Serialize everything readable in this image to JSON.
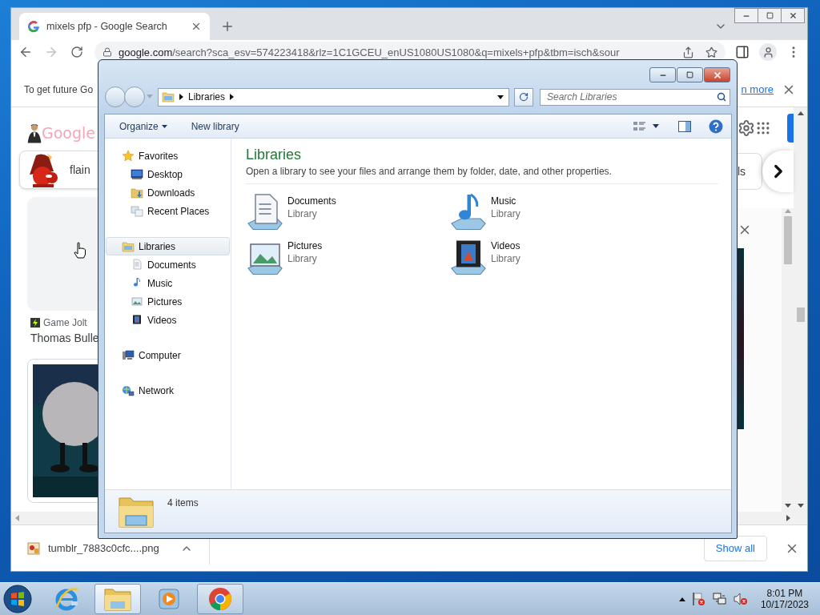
{
  "browser": {
    "tab": {
      "title": "mixels pfp - Google Search",
      "selected": true
    },
    "address": {
      "host": "google.com",
      "path": "/search?sca_esv=574223418&rlz=1C1GCEU_enUS1080US1080&q=mixels+pfp&tbm=isch&sour"
    },
    "infobar": {
      "text": "To get future Go",
      "link": "n more"
    },
    "logo": "Google",
    "chips": [
      {
        "label": "flain",
        "kind": "picture"
      },
      {
        "label": "ls",
        "kind": "plain"
      }
    ],
    "result": {
      "source": "Game Jolt",
      "title": "Thomas Bulle"
    },
    "download": {
      "file": "tumblr_7883c0cfc....png",
      "show_all": "Show all"
    }
  },
  "explorer": {
    "breadcrumb": "Libraries",
    "search_placeholder": "Search Libraries",
    "commands": [
      {
        "label": "Organize",
        "kind": "menu"
      },
      {
        "label": "New library",
        "kind": "button"
      }
    ],
    "nav": [
      {
        "label": "Favorites",
        "kind": "star",
        "selected": false,
        "children": [
          {
            "label": "Desktop",
            "kind": "desktop",
            "selected": false
          },
          {
            "label": "Downloads",
            "kind": "downloads",
            "selected": false
          },
          {
            "label": "Recent Places",
            "kind": "recent",
            "selected": false
          }
        ]
      },
      {
        "label": "Libraries",
        "kind": "library",
        "selected": true,
        "children": [
          {
            "label": "Documents",
            "kind": "documents",
            "selected": false
          },
          {
            "label": "Music",
            "kind": "music",
            "selected": false
          },
          {
            "label": "Pictures",
            "kind": "pictures",
            "selected": false
          },
          {
            "label": "Videos",
            "kind": "videos",
            "selected": false
          }
        ]
      },
      {
        "label": "Computer",
        "kind": "computer",
        "selected": false
      },
      {
        "label": "Network",
        "kind": "network",
        "selected": false
      }
    ],
    "heading": "Libraries",
    "description": "Open a library to see your files and arrange them by folder, date, and other properties.",
    "items": [
      {
        "name": "Documents",
        "type": "Library",
        "kind": "documents"
      },
      {
        "name": "Music",
        "type": "Library",
        "kind": "music"
      },
      {
        "name": "Pictures",
        "type": "Library",
        "kind": "pictures"
      },
      {
        "name": "Videos",
        "type": "Library",
        "kind": "videos"
      }
    ],
    "details": "4 items"
  },
  "taskbar": {
    "buttons": [
      {
        "kind": "ie",
        "open": false,
        "selected": false
      },
      {
        "kind": "explorer",
        "open": true,
        "selected": true
      },
      {
        "kind": "media",
        "open": false,
        "selected": false
      },
      {
        "kind": "chrome",
        "open": true,
        "selected": false
      }
    ],
    "time": "8:01 PM",
    "date": "10/17/2023"
  }
}
